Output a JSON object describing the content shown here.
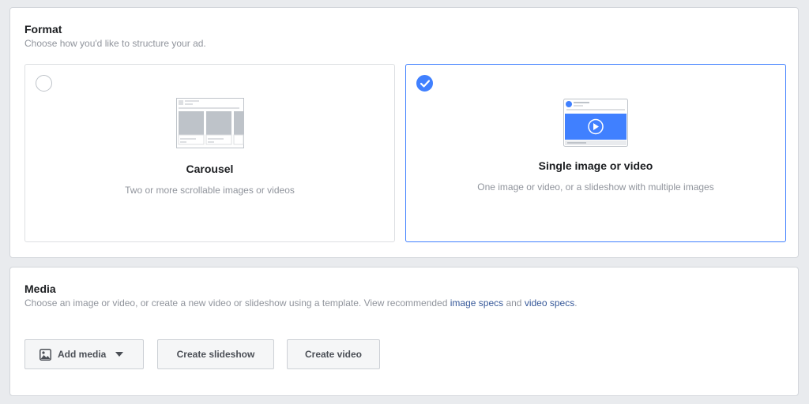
{
  "format": {
    "title": "Format",
    "description": "Choose how you'd like to structure your ad.",
    "options": [
      {
        "title": "Carousel",
        "description": "Two or more scrollable images or videos",
        "selected": false,
        "icon": "carousel-layout-icon"
      },
      {
        "title": "Single image or video",
        "description": "One image or video, or a slideshow with multiple images",
        "selected": true,
        "icon": "single-image-video-layout-icon"
      }
    ]
  },
  "media": {
    "title": "Media",
    "description_prefix": "Choose an image or video, or create a new video or slideshow using a template. View recommended ",
    "image_specs_link": "image specs",
    "and_text": " and ",
    "video_specs_link": "video specs",
    "suffix": ".",
    "buttons": {
      "add_media": "Add media",
      "create_slideshow": "Create slideshow",
      "create_video": "Create video"
    }
  },
  "colors": {
    "accent": "#4080ff",
    "link": "#365899",
    "background": "#e9ebee"
  }
}
